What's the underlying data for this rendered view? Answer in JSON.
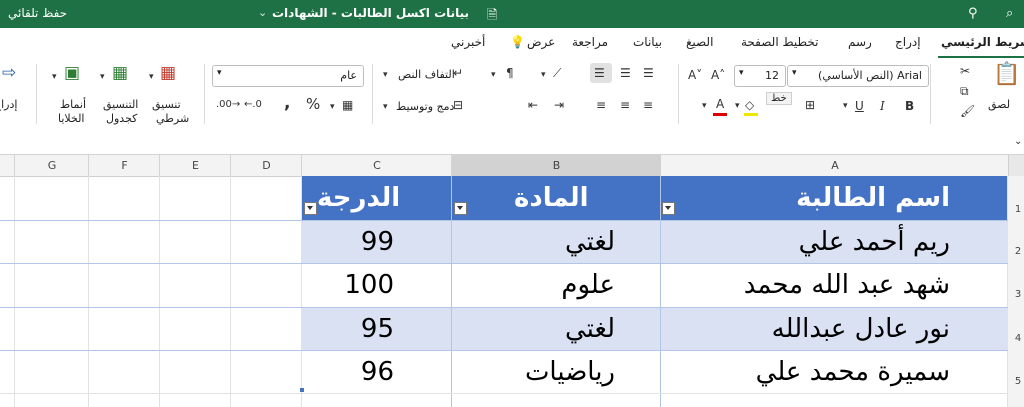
{
  "titlebar": {
    "autosave": "حفظ تلقائي",
    "doc_title": "بيانات اكسل الطالبات - الشهادات"
  },
  "tabs": [
    "الشريط الرئيسي",
    "إدراج",
    "رسم",
    "تخطيط الصفحة",
    "الصيغ",
    "بيانات",
    "مراجعة",
    "عرض",
    "أخبرني"
  ],
  "ribbon": {
    "paste": "لصق",
    "font_name": "(النص الأساسي) Arial",
    "font_size": "12",
    "tooltip": "خط",
    "wrap_text": "التفاف النص",
    "merge_center": "دمج وتوسيط",
    "number_format": "عام",
    "conditional_format": [
      "تنسيق",
      "شرطي"
    ],
    "format_table": [
      "التنسيق",
      "كجدول"
    ],
    "cell_styles": [
      "أنماط",
      "الخلايا"
    ],
    "insert": "إدراج"
  },
  "columns": [
    "A",
    "B",
    "C",
    "D",
    "E",
    "F",
    "G"
  ],
  "rows": [
    "1",
    "2",
    "3",
    "4",
    "5"
  ],
  "table": {
    "headers": [
      "اسم الطالبة",
      "المادة",
      "الدرجة"
    ],
    "rows": [
      [
        "ريم أحمد علي",
        "لغتي",
        "99"
      ],
      [
        "شهد عبد الله محمد",
        "علوم",
        "100"
      ],
      [
        "نور عادل عبدالله",
        "لغتي",
        "95"
      ],
      [
        "سميرة محمد علي",
        "رياضيات",
        "96"
      ]
    ]
  },
  "colors": {
    "excel_green": "#1e7145",
    "header_blue": "#4472c4",
    "band_blue": "#d9e1f2"
  }
}
